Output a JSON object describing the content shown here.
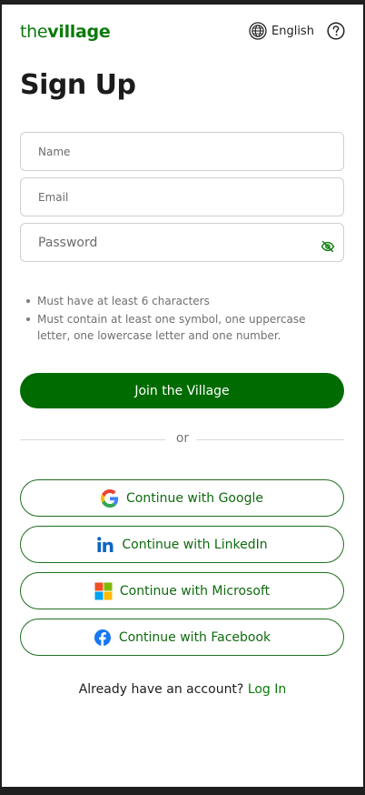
{
  "brand": {
    "logo_prefix": "the",
    "logo_suffix": "village"
  },
  "header": {
    "language": "English"
  },
  "page": {
    "title": "Sign Up"
  },
  "form": {
    "name_placeholder": "Name",
    "email_placeholder": "Email",
    "password_placeholder": "Password"
  },
  "password_rules": [
    "Must have at least 6 characters",
    "Must contain at least one symbol, one uppercase letter, one lowercase letter and one number."
  ],
  "primary_button": "Join the Village",
  "divider_text": "or",
  "social_buttons": {
    "google": "Continue with Google",
    "linkedin": "Continue with LinkedIn",
    "microsoft": "Continue with Microsoft",
    "facebook": "Continue with Facebook"
  },
  "footer": {
    "prompt": "Already have an account?",
    "link": "Log In"
  },
  "colors": {
    "brand_green": "#006b00",
    "text_green": "#0b7a0b"
  },
  "icons": [
    "globe-icon",
    "help-icon",
    "eye-off-icon",
    "google-icon",
    "linkedin-icon",
    "microsoft-icon",
    "facebook-icon"
  ]
}
